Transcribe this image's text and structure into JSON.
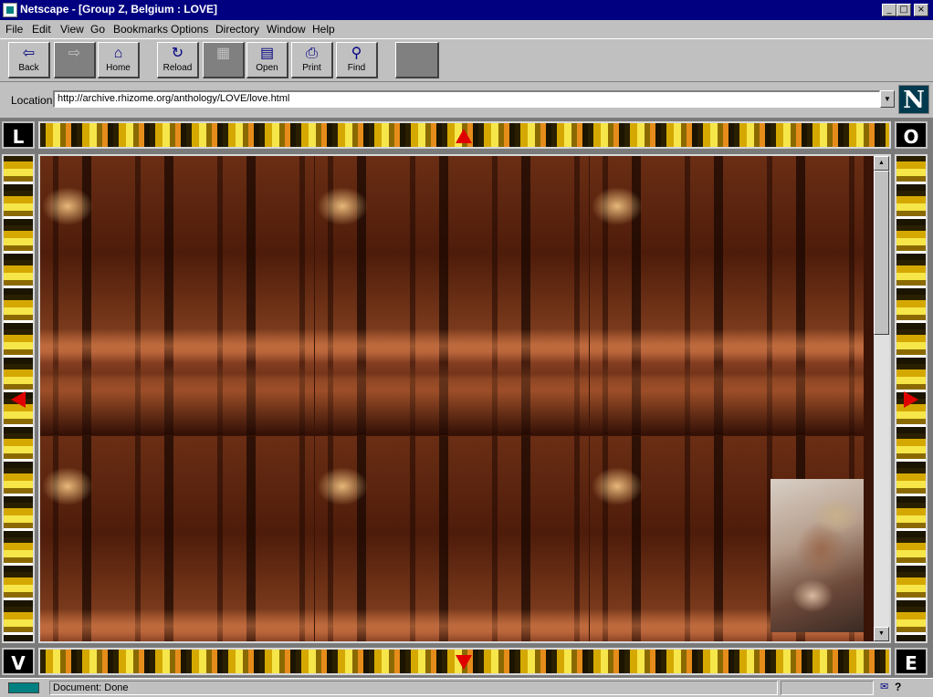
{
  "window": {
    "title": "Netscape - [Group Z, Belgium : LOVE]"
  },
  "window_controls": {
    "minimize": "_",
    "maximize": "□",
    "close": "×"
  },
  "menu": [
    "File",
    "Edit",
    "View",
    "Go",
    "Bookmarks",
    "Options",
    "Directory",
    "Window",
    "Help"
  ],
  "toolbar": {
    "back": "Back",
    "forward": "",
    "home": "Home",
    "reload": "Reload",
    "images": "",
    "open": "Open",
    "print": "Print",
    "find": "Find",
    "stop": ""
  },
  "location": {
    "label": "Location:",
    "url": "http://archive.rhizome.org/anthology/LOVE/love.html"
  },
  "logo": "N",
  "corners": {
    "top_left": "L",
    "top_right": "O",
    "bottom_left": "V",
    "bottom_right": "E"
  },
  "status": {
    "text": "Document: Done"
  },
  "icons": {
    "back": "arrow-left-icon",
    "forward": "arrow-right-icon",
    "home": "home-icon",
    "reload": "reload-icon",
    "images": "images-icon",
    "open": "open-icon",
    "print": "printer-icon",
    "find": "binoculars-icon"
  },
  "colors": {
    "title_bar": "#000080",
    "chrome": "#c0c0c0",
    "arrow_red": "#e00000"
  }
}
